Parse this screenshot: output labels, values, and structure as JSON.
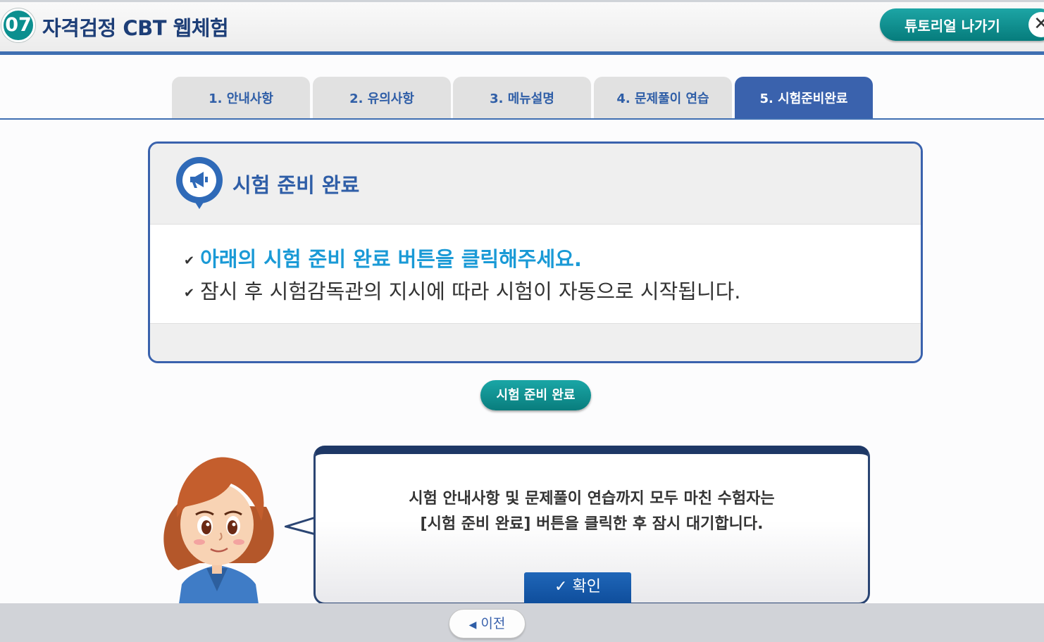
{
  "header": {
    "step_number": "07",
    "title": "자격검정 CBT 웹체험",
    "exit_label": "튜토리얼 나가기",
    "exit_icon": "close-icon"
  },
  "tabs": [
    {
      "label": "1. 안내사항",
      "active": false
    },
    {
      "label": "2. 유의사항",
      "active": false
    },
    {
      "label": "3. 메뉴설명",
      "active": false
    },
    {
      "label": "4. 문제풀이 연습",
      "active": false
    },
    {
      "label": "5. 시험준비완료",
      "active": true
    }
  ],
  "panel": {
    "icon": "megaphone-icon",
    "title": "시험 준비 완료",
    "check_mark": "✔",
    "line1": "아래의 시험 준비 완료 버튼을 클릭해주세요.",
    "line2": "잠시 후 시험감독관의 지시에 따라 시험이 자동으로 시작됩니다."
  },
  "ready_button": "시험 준비 완료",
  "bubble": {
    "text1": "시험 안내사항 및 문제풀이 연습까지 모두 마친 수험자는",
    "text2": "[시험 준비 완료] 버튼을 클릭한 후 잠시 대기합니다.",
    "confirm_label": "확인",
    "confirm_icon": "checkmark-icon"
  },
  "footer": {
    "prev_label": "이전",
    "prev_icon": "left-triangle-icon"
  },
  "colors": {
    "primary_blue": "#3a62ad",
    "teal": "#0b8f8f",
    "highlight_text": "#1a9ad6"
  }
}
